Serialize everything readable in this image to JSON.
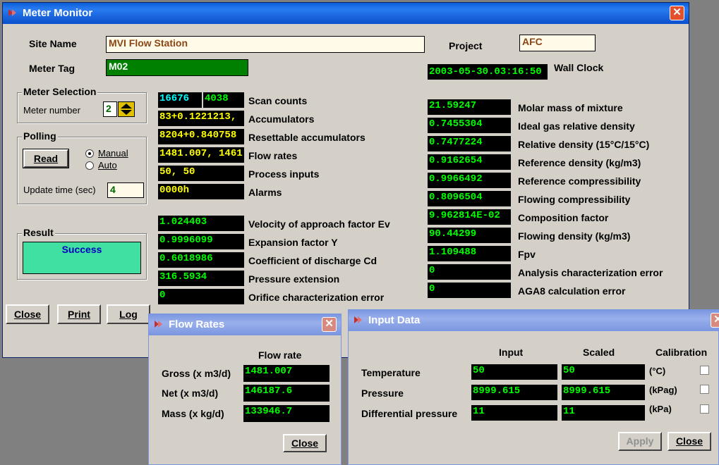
{
  "main": {
    "title": "Meter Monitor",
    "site_name_label": "Site Name",
    "site_name_value": "MVI Flow Station",
    "meter_tag_label": "Meter Tag",
    "meter_tag_value": "M02",
    "project_label": "Project",
    "project_value": "AFC",
    "wall_clock_value": "2003-05-30.03:16:50",
    "wall_clock_label": "Wall Clock",
    "meter_selection": {
      "title": "Meter Selection",
      "meter_number_label": "Meter number",
      "meter_number_value": "2"
    },
    "polling": {
      "title": "Polling",
      "read_button": "Read",
      "manual_label": "Manual",
      "auto_label": "Auto",
      "selected_mode": "Manual",
      "update_time_label": "Update time (sec)",
      "update_time_value": "4"
    },
    "result": {
      "title": "Result",
      "value": "Success"
    },
    "buttons": {
      "close": "Close",
      "print": "Print",
      "log": "Log"
    },
    "counts": {
      "scan_a": "16676",
      "scan_b": "4038"
    },
    "left_rows": [
      {
        "value": "83+0.1221213,",
        "label": "Accumulators"
      },
      {
        "value": "8204+0.840758",
        "label": "Resettable accumulators"
      },
      {
        "value": "1481.007, 1461",
        "label": "Flow rates"
      },
      {
        "value": "50, 50",
        "label": "Process inputs"
      },
      {
        "value": "0000h",
        "label": "Alarms"
      }
    ],
    "scan_counts_label": "Scan counts",
    "left_rows2": [
      {
        "value": "1.024403",
        "label": "Velocity of approach factor Ev"
      },
      {
        "value": "0.9996099",
        "label": "Expansion factor Y"
      },
      {
        "value": "0.6018986",
        "label": "Coefficient of discharge Cd"
      },
      {
        "value": "316.5934",
        "label": "Pressure extension"
      },
      {
        "value": "0",
        "label": "Orifice characterization error"
      }
    ],
    "right_rows": [
      {
        "value": "21.59247",
        "label": "Molar mass of mixture"
      },
      {
        "value": "0.7455304",
        "label": "Ideal gas relative density"
      },
      {
        "value": "0.7477224",
        "label": "Relative density (15°C/15°C)"
      },
      {
        "value": "0.9162654",
        "label": "Reference density (kg/m3)"
      },
      {
        "value": "0.9966492",
        "label": "Reference compressibility"
      },
      {
        "value": "0.8096504",
        "label": "Flowing compressibility"
      },
      {
        "value": "9.962814E-02",
        "label": "Composition factor"
      },
      {
        "value": "90.44299",
        "label": "Flowing density (kg/m3)"
      },
      {
        "value": "1.109488",
        "label": "Fpv"
      },
      {
        "value": "0",
        "label": "Analysis characterization error"
      },
      {
        "value": "0",
        "label": "AGA8 calculation error"
      }
    ]
  },
  "flow_rates": {
    "title": "Flow Rates",
    "header": "Flow rate",
    "rows": [
      {
        "label": "Gross (x m3/d)",
        "value": "1481.007"
      },
      {
        "label": "Net (x m3/d)",
        "value": "146187.6"
      },
      {
        "label": "Mass (x kg/d)",
        "value": "133946.7"
      }
    ],
    "close": "Close"
  },
  "input_data": {
    "title": "Input Data",
    "headers": {
      "input": "Input",
      "scaled": "Scaled",
      "calibration": "Calibration"
    },
    "rows": [
      {
        "label": "Temperature",
        "input": "50",
        "scaled": "50",
        "unit": "(°C)"
      },
      {
        "label": "Pressure",
        "input": "8999.615",
        "scaled": "8999.615",
        "unit": "(kPag)"
      },
      {
        "label": "Differential pressure",
        "input": "11",
        "scaled": "11",
        "unit": "(kPa)"
      }
    ],
    "apply": "Apply",
    "close": "Close"
  },
  "colors": {
    "titlebar": "#0a5fd8",
    "dialog_bg": "#d4d0c8",
    "result_bg": "#40e0a0",
    "value_green": "#00ff00",
    "value_yellow": "#ffff00",
    "value_cyan": "#00ffff"
  }
}
